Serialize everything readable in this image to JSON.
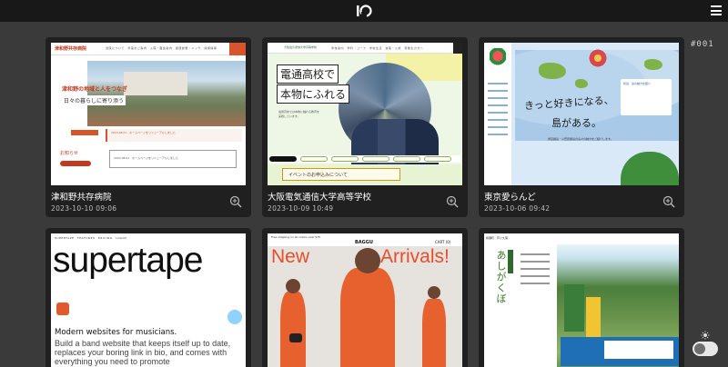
{
  "app": {
    "side_code": "#001"
  },
  "cards": [
    {
      "title": "津和野共存病院",
      "date": "2023-10-10 09:06",
      "preview": {
        "brand": "津和野共存病院",
        "nav": "当院について　外来のご案内　入院・面会案内　健康診断・ドック　採用情報",
        "hero_line1": "津和野の地域と人をつなぎ",
        "hero_line2": "日々の暮らしに寄り添う",
        "news_label": "2023.08.01　ホームページをリニューアルしました",
        "notice_label": "お知らせ",
        "notice_text": "2023.08.01　ホームページをリニューアルしました"
      }
    },
    {
      "title": "大阪電気通信大学高等学校",
      "date": "2023-10-09 10:49",
      "preview": {
        "logo": "大阪電気通信大学高等学校",
        "nav": "学校案内　学科・コース　学校生活　進路・入試　受験生の方へ",
        "head1": "電通高校で",
        "head2": "本物にふれる",
        "small": "電通高校では本物に触れる教育を実践しています。",
        "event": "イベントのお申込みについて"
      }
    },
    {
      "title": "東京愛らんど",
      "date": "2023-10-06 09:42",
      "preview": {
        "calli1": "きっと好きになる、",
        "calli2": "島がある。",
        "card_text": "利島　島の魅力を紹介",
        "body": "伊豆諸島・小笠原諸島の島々の魅力をご紹介します。"
      }
    },
    {
      "title": "",
      "date": "",
      "preview": {
        "nav": "SUPERTAPE　FEATURES　PRICING　LOGIN",
        "big": "supertape",
        "sub": "Modern websites for musicians.",
        "para": "Build a band website that keeps itself up to date, replaces your boring link in bio, and comes with everything you need to promote"
      }
    },
    {
      "title": "",
      "date": "",
      "preview": {
        "nav": "Free shipping on all orders over $75",
        "brand": "BAGGU",
        "cart": "CART (0)",
        "banner1": "New",
        "banner2": "Arrivals!"
      }
    },
    {
      "title": "",
      "date": "",
      "preview": {
        "vertical": "あしがくぼ",
        "header": "横瀬町　芦ヶ久保",
        "tag": "里山の魅力"
      }
    }
  ],
  "icons": {
    "logo": "io-logo-icon",
    "menu": "hamburger-menu-icon",
    "zoom": "zoom-in-icon",
    "theme": "sun-icon"
  }
}
